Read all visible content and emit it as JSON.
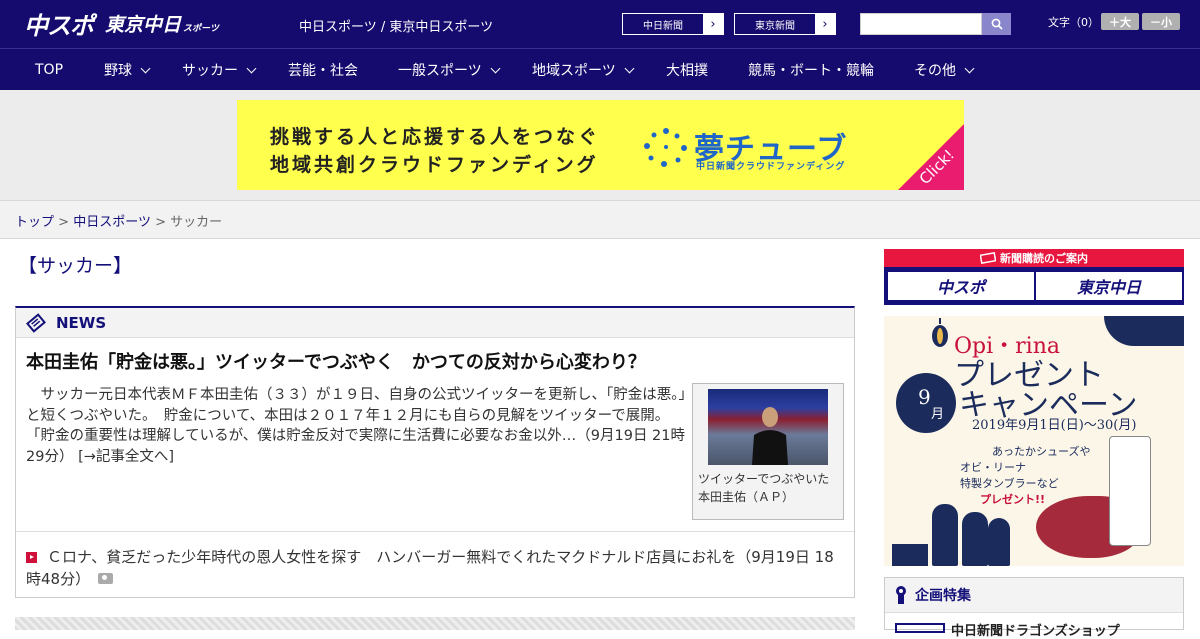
{
  "header": {
    "logo_main": "中スポ",
    "logo_sub": "東京中日",
    "logo_sub2": "スポーツ",
    "site_name": "中日スポーツ / 東京中日スポーツ",
    "paper_buttons": [
      {
        "label": "中日新聞",
        "arrow": "›"
      },
      {
        "label": "東京新聞",
        "arrow": "›"
      }
    ],
    "search_placeholder": "",
    "font_size_label": "文字（0）",
    "font_up_label": "＋大",
    "font_down_label": "－小"
  },
  "nav": {
    "items": [
      {
        "label": "TOP",
        "dropdown": false
      },
      {
        "label": "野球",
        "dropdown": true
      },
      {
        "label": "サッカー",
        "dropdown": true
      },
      {
        "label": "芸能・社会",
        "dropdown": false
      },
      {
        "label": "一般スポーツ",
        "dropdown": true
      },
      {
        "label": "地域スポーツ",
        "dropdown": true
      },
      {
        "label": "大相撲",
        "dropdown": false
      },
      {
        "label": "競馬・ボート・競輪",
        "dropdown": false
      },
      {
        "label": "その他",
        "dropdown": true
      }
    ]
  },
  "banner": {
    "line1": "挑戦する人と応援する人をつなぐ",
    "line2": "地域共創クラウドファンディング",
    "brand": "夢チューブ",
    "brand_sub": "中日新聞クラウドファンディング",
    "click": "Click!"
  },
  "breadcrumb": {
    "items": [
      "トップ",
      "中日スポーツ"
    ],
    "separator": ">",
    "current": "サッカー"
  },
  "page_title": "【サッカー】",
  "news": {
    "section_label": "NEWS",
    "headline": "本田圭佑「貯金は悪。」ツイッターでつぶやく　かつての反対から心変わり？",
    "body": "　サッカー元日本代表ＭＦ本田圭佑（３３）が１９日、自身の公式ツイッターを更新し、「貯金は悪。」と短くつぶやいた。　貯金について、本田は２０１７年１２月にも自らの見解をツイッターで展開。「貯金の重要性は理解しているが、僕は貯金反対で実際に生活費に必要なお金以外…（9月19日 21時29分）",
    "read_more": "[→記事全文へ]",
    "photo_caption": "ツイッターでつぶやいた本田圭佑（ＡＰ）",
    "sub_headline": "Ｃロナ、貧乏だった少年時代の恩人女性を探す　ハンバーガー無料でくれたマクドナルド店員にお礼を（9月19日 18時48分）"
  },
  "sidebar": {
    "subscribe_title": "新聞購読のご案内",
    "subscribe_buttons": [
      "中スポ",
      "東京中日"
    ],
    "promo": {
      "brand": "Opi・rina",
      "title_line1": "プレゼント",
      "title_line2": "キャンペーン",
      "month_num": "9",
      "month_unit": "月",
      "dates": "2019年9月1日(日)〜30(月)",
      "copy1": "あったかシューズや",
      "copy2": "オビ・リーナ",
      "copy3": "特製タンブラーなど",
      "copy4": "プレゼント!!"
    },
    "feature_title": "企画特集",
    "feature_item": "中日新聞ドラゴンズショップ"
  },
  "colors": {
    "navy": "#150a6e",
    "accent_red": "#e8173f",
    "banner_yellow": "#ffff4d",
    "banner_blue": "#1f66c8",
    "click_pink": "#ea1c6f"
  }
}
